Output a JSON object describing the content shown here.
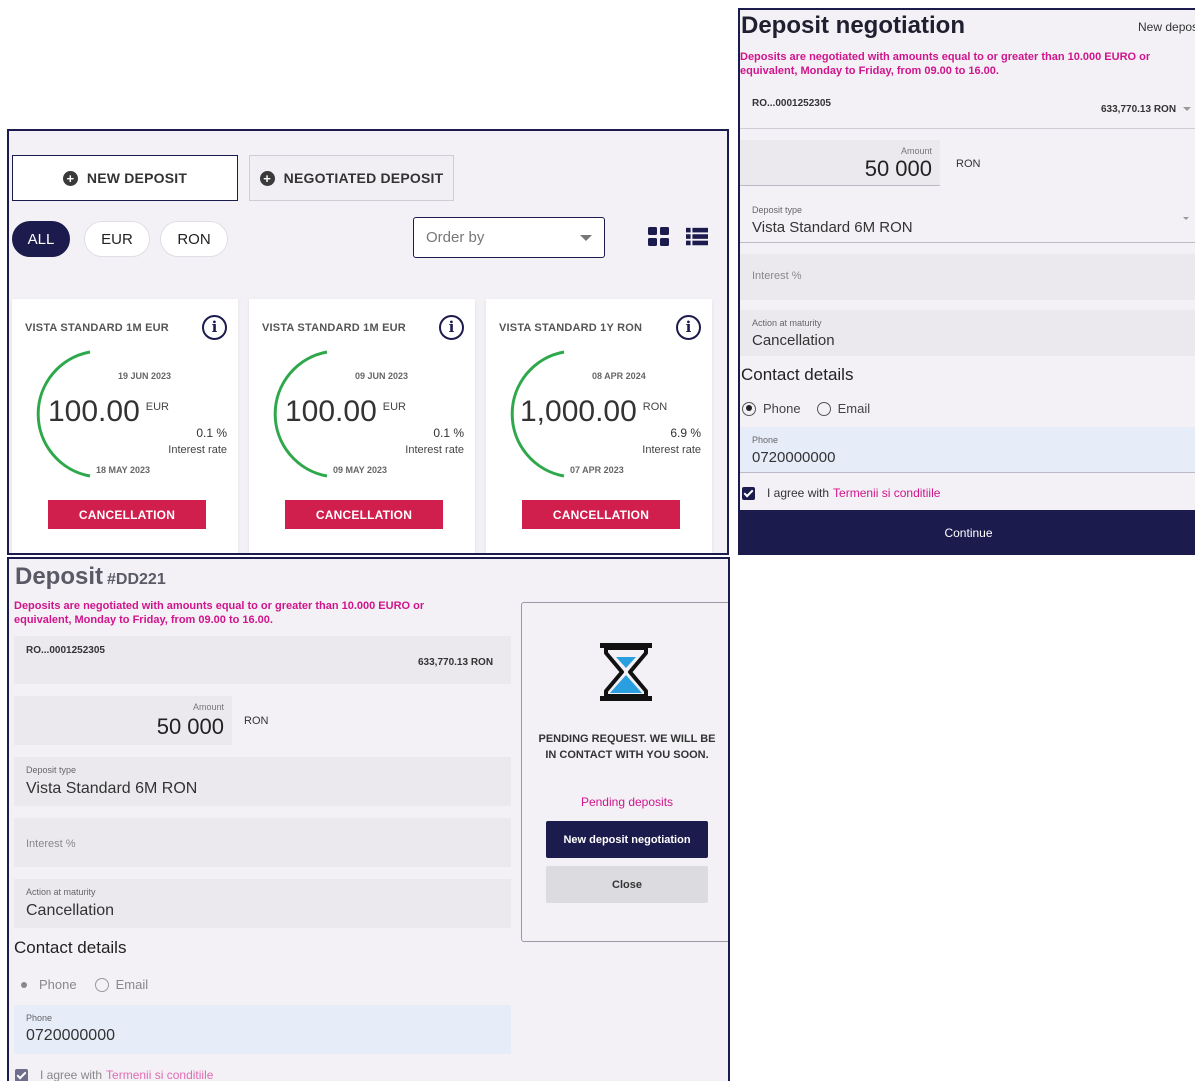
{
  "list": {
    "new_deposit": "NEW DEPOSIT",
    "negotiated_deposit": "NEGOTIATED DEPOSIT",
    "filters": [
      "ALL",
      "EUR",
      "RON"
    ],
    "order_by_placeholder": "Order by",
    "cards": [
      {
        "title": "VISTA STANDARD 1M EUR",
        "maturity": "19 JUN 2023",
        "amount": "100.00",
        "currency": "EUR",
        "rate": "0.1 %",
        "rate_label": "Interest rate",
        "start": "18 MAY 2023",
        "action": "CANCELLATION",
        "progress": 0.45
      },
      {
        "title": "VISTA STANDARD 1M EUR",
        "maturity": "09 JUN 2023",
        "amount": "100.00",
        "currency": "EUR",
        "rate": "0.1 %",
        "rate_label": "Interest rate",
        "start": "09 MAY 2023",
        "action": "CANCELLATION",
        "progress": 0.45
      },
      {
        "title": "VISTA STANDARD 1Y RON",
        "maturity": "08 APR 2024",
        "amount": "1,000.00",
        "currency": "RON",
        "rate": "6.9 %",
        "rate_label": "Interest rate",
        "start": "07 APR 2023",
        "action": "CANCELLATION",
        "progress": 0.45
      }
    ],
    "colors": {
      "accent": "#1c1b4d",
      "cancel": "#d01f4d",
      "progress": "#2ea84a"
    }
  },
  "negotiation": {
    "title": "Deposit negotiation",
    "new_link": "New depos",
    "notice": "Deposits are negotiated with amounts equal to or greater than 10.000 EURO or equivalent, Monday to Friday, from 09.00 to 16.00.",
    "account_number": "RO...0001252305",
    "account_balance": "633,770.13 RON",
    "amount_label": "Amount",
    "amount_value": "50 000",
    "amount_currency": "RON",
    "deposit_type_label": "Deposit type",
    "deposit_type_value": "Vista Standard 6M RON",
    "interest_label": "Interest %",
    "maturity_label": "Action at maturity",
    "maturity_value": "Cancellation",
    "contact_title": "Contact details",
    "phone_option": "Phone",
    "email_option": "Email",
    "phone_label": "Phone",
    "phone_value": "0720000000",
    "agree_text": "I agree with",
    "agree_link": "Termenii si conditiile",
    "continue": "Continue"
  },
  "detail": {
    "title": "Deposit",
    "code": "#DD221",
    "notice": "Deposits are negotiated with amounts equal to or greater than 10.000 EURO or equivalent, Monday to Friday, from 09.00 to 16.00.",
    "account_number": "RO...0001252305",
    "account_balance": "633,770.13 RON",
    "amount_label": "Amount",
    "amount_value": "50 000",
    "amount_currency": "RON",
    "deposit_type_label": "Deposit type",
    "deposit_type_value": "Vista Standard 6M RON",
    "interest_label": "Interest %",
    "maturity_label": "Action at maturity",
    "maturity_value": "Cancellation",
    "contact_title": "Contact details",
    "phone_option": "Phone",
    "email_option": "Email",
    "phone_label": "Phone",
    "phone_value": "0720000000",
    "agree_text": "I agree with",
    "agree_link": "Termenii si conditiile",
    "pending": {
      "icon": "hourglass-icon",
      "message": "PENDING REQUEST. WE WILL BE IN CONTACT WITH YOU SOON.",
      "link": "Pending deposits",
      "new_negotiation": "New deposit negotiation",
      "close": "Close"
    }
  }
}
